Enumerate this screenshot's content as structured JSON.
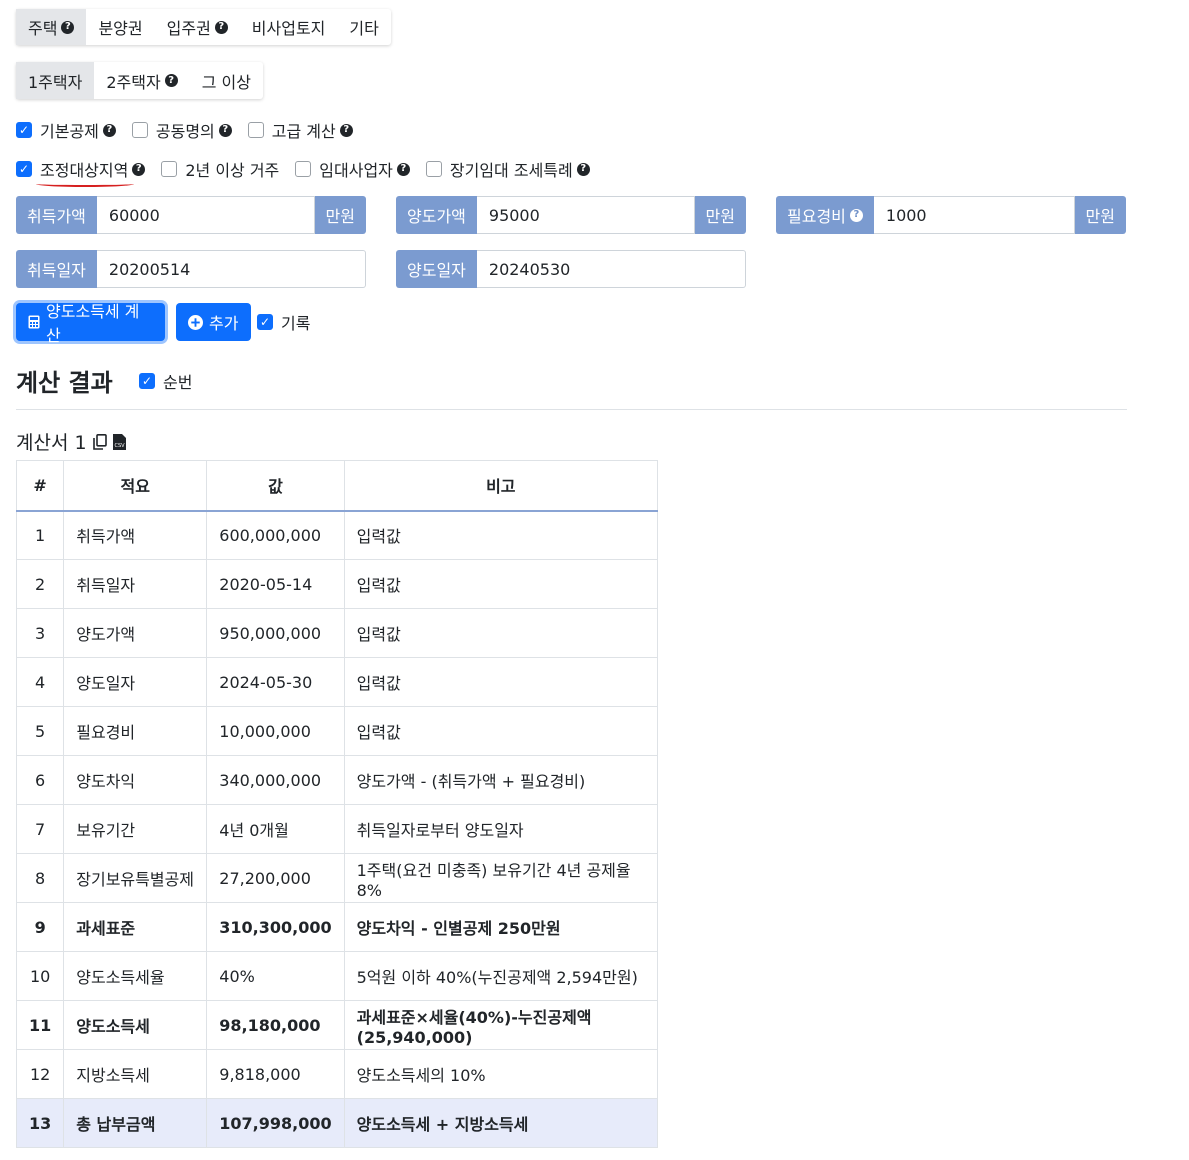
{
  "tabs_type": [
    {
      "label": "주택",
      "help": true,
      "active": true
    },
    {
      "label": "분양권",
      "help": false,
      "active": false
    },
    {
      "label": "입주권",
      "help": true,
      "active": false
    },
    {
      "label": "비사업토지",
      "help": false,
      "active": false
    },
    {
      "label": "기타",
      "help": false,
      "active": false
    }
  ],
  "tabs_owner": [
    {
      "label": "1주택자",
      "help": false,
      "active": true
    },
    {
      "label": "2주택자",
      "help": true,
      "active": false
    },
    {
      "label": "그 이상",
      "help": false,
      "active": false
    }
  ],
  "options_row1": [
    {
      "label": "기본공제",
      "checked": true,
      "help": true
    },
    {
      "label": "공동명의",
      "checked": false,
      "help": true
    },
    {
      "label": "고급 계산",
      "checked": false,
      "help": true
    }
  ],
  "options_row2": [
    {
      "label": "조정대상지역",
      "checked": true,
      "help": true
    },
    {
      "label": "2년 이상 거주",
      "checked": false,
      "help": false
    },
    {
      "label": "임대사업자",
      "checked": false,
      "help": true
    },
    {
      "label": "장기임대 조세특례",
      "checked": false,
      "help": true
    }
  ],
  "inputs": {
    "acq_price": {
      "label": "취득가액",
      "value": "60000",
      "unit": "만원"
    },
    "sale_price": {
      "label": "양도가액",
      "value": "95000",
      "unit": "만원"
    },
    "expense": {
      "label": "필요경비",
      "value": "1000",
      "unit": "만원"
    },
    "acq_date": {
      "label": "취득일자",
      "value": "20200514"
    },
    "sale_date": {
      "label": "양도일자",
      "value": "20240530"
    }
  },
  "buttons": {
    "calc": "양도소득세 계산",
    "add": "추가",
    "record_label": "기록"
  },
  "result": {
    "title": "계산 결과",
    "seq_label": "순번",
    "sheet_title": "계산서 1"
  },
  "table": {
    "headers": [
      "#",
      "적요",
      "값",
      "비고"
    ],
    "rows": [
      {
        "no": "1",
        "item": "취득가액",
        "value": "600,000,000",
        "note": "입력값"
      },
      {
        "no": "2",
        "item": "취득일자",
        "value": "2020-05-14",
        "note": "입력값"
      },
      {
        "no": "3",
        "item": "양도가액",
        "value": "950,000,000",
        "note": "입력값"
      },
      {
        "no": "4",
        "item": "양도일자",
        "value": "2024-05-30",
        "note": "입력값"
      },
      {
        "no": "5",
        "item": "필요경비",
        "value": "10,000,000",
        "note": "입력값"
      },
      {
        "no": "6",
        "item": "양도차익",
        "value": "340,000,000",
        "note": "양도가액 - (취득가액 + 필요경비)"
      },
      {
        "no": "7",
        "item": "보유기간",
        "value": "4년 0개월",
        "note": "취득일자로부터 양도일자"
      },
      {
        "no": "8",
        "item": "장기보유특별공제",
        "value": "27,200,000",
        "note": "1주택(요건 미충족) 보유기간 4년 공제율 8%"
      },
      {
        "no": "9",
        "item": "과세표준",
        "value": "310,300,000",
        "note": "양도차익 - 인별공제 250만원",
        "bold": true
      },
      {
        "no": "10",
        "item": "양도소득세율",
        "value": "40%",
        "note": "5억원 이하 40%(누진공제액 2,594만원)"
      },
      {
        "no": "11",
        "item": "양도소득세",
        "value": "98,180,000",
        "note": "과세표준×세율(40%)-누진공제액(25,940,000)",
        "bold": true
      },
      {
        "no": "12",
        "item": "지방소득세",
        "value": "9,818,000",
        "note": "양도소득세의 10%"
      },
      {
        "no": "13",
        "item": "총 납부금액",
        "value": "107,998,000",
        "note": "양도소득세 + 지방소득세",
        "total": true
      }
    ]
  }
}
